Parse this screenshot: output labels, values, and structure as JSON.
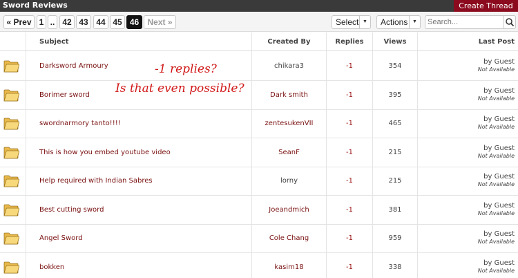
{
  "header": {
    "title": "Sword Reviews",
    "create_label": "Create Thread"
  },
  "pagination": {
    "prev": "« Prev",
    "pages": [
      "1",
      "..",
      "42",
      "43",
      "44",
      "45",
      "46"
    ],
    "current": "46",
    "next": "Next »"
  },
  "toolbar": {
    "select_label": "Select",
    "actions_label": "Actions",
    "search_placeholder": "Search..."
  },
  "columns": {
    "subject": "Subject",
    "created_by": "Created By",
    "replies": "Replies",
    "views": "Views",
    "last_post": "Last Post"
  },
  "threads": [
    {
      "subject": "Darksword Armoury",
      "created_by": "chikara3",
      "replies": "-1",
      "views": "354",
      "last_by": "by Guest",
      "last_date": "Not Available"
    },
    {
      "subject": "Borimer sword",
      "created_by": "Dark smith",
      "replies": "-1",
      "views": "395",
      "last_by": "by Guest",
      "last_date": "Not Available"
    },
    {
      "subject": "swordnarmory tanto!!!!",
      "created_by": "zentesukenVII",
      "replies": "-1",
      "views": "465",
      "last_by": "by Guest",
      "last_date": "Not Available"
    },
    {
      "subject": "This is how you embed youtube video",
      "created_by": "SeanF",
      "replies": "-1",
      "views": "215",
      "last_by": "by Guest",
      "last_date": "Not Available"
    },
    {
      "subject": "Help required with Indian Sabres",
      "created_by": "lorny",
      "replies": "-1",
      "views": "215",
      "last_by": "by Guest",
      "last_date": "Not Available"
    },
    {
      "subject": "Best cutting sword",
      "created_by": "Joeandmich",
      "replies": "-1",
      "views": "381",
      "last_by": "by Guest",
      "last_date": "Not Available"
    },
    {
      "subject": "Angel Sword",
      "created_by": "Cole Chang",
      "replies": "-1",
      "views": "959",
      "last_by": "by Guest",
      "last_date": "Not Available"
    },
    {
      "subject": "bokken",
      "created_by": "kasim18",
      "replies": "-1",
      "views": "338",
      "last_by": "by Guest",
      "last_date": "Not Available"
    }
  ],
  "annotation": {
    "line1": "-1 replies?",
    "line2": "Is that even possible?"
  },
  "icons": {
    "folder": "folder-icon",
    "search": "search-icon",
    "caret": "caret-down-icon"
  },
  "colors": {
    "accent": "#8b0a1e",
    "link": "#7a1010",
    "annotation": "#d11818"
  }
}
